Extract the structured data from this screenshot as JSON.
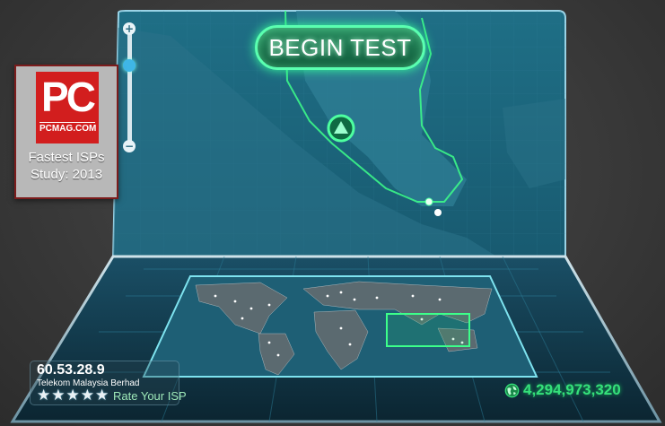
{
  "badge": {
    "logo_text": "PC",
    "site": "PCMAG.COM",
    "caption_line1": "Fastest ISPs",
    "caption_line2": "Study: 2013"
  },
  "test_button": {
    "label": "BEGIN TEST"
  },
  "connection": {
    "ip": "60.53.28.9",
    "isp": "Telekom Malaysia Berhad",
    "rating_stars": 5,
    "rate_link": "Rate Your ISP"
  },
  "servers": {
    "count": "4,294,973,320"
  },
  "icons": {
    "zoom_in": "plus-icon",
    "zoom_out": "minus-icon",
    "server_pin": "triangle-marker-icon",
    "globe": "globe-icon",
    "star": "star-icon"
  },
  "colors": {
    "accent_green": "#35e07a",
    "map_cyan": "#3fb6e6",
    "badge_red": "#d21e1e"
  }
}
